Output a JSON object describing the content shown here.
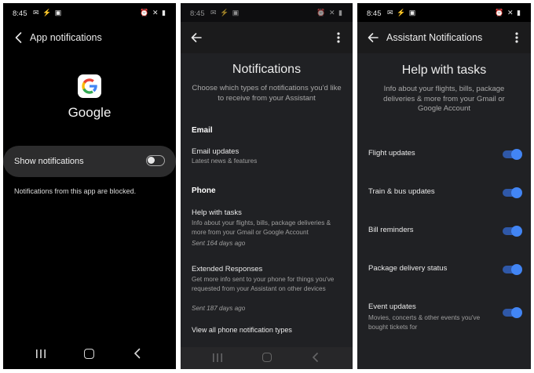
{
  "screen1": {
    "status_time": "8:45",
    "status_icons_left": "✉ ⚡ ▣",
    "status_icons_right": "⏰ ✕ ▮",
    "title": "App notifications",
    "app_name": "Google",
    "show_label": "Show notifications",
    "show_toggle_on": false,
    "blocked_text": "Notifications from this app are blocked."
  },
  "screen2": {
    "status_time": "8:45",
    "status_icons_left": "✉ ⚡ ▣",
    "status_icons_right": "⏰ ✕ ▮",
    "title": "Notifications",
    "subtitle": "Choose which types of notifications you'd like to receive from your Assistant",
    "email_section": "Email",
    "email_updates": {
      "title": "Email updates",
      "desc": "Latest news & features"
    },
    "phone_section": "Phone",
    "help_tasks": {
      "title": "Help with tasks",
      "desc": "Info about your flights, bills, package deliveries & more from your Gmail or Google Account",
      "meta": "Sent 164 days ago"
    },
    "extended": {
      "title": "Extended Responses",
      "desc": "Get more info sent to your phone for things you've requested from your Assistant on other devices",
      "meta": "Sent 187 days ago"
    },
    "view_all": "View all phone notification types"
  },
  "screen3": {
    "status_time": "8:45",
    "status_icons_left": "✉ ⚡ ▣",
    "status_icons_right": "⏰ ✕ ▮",
    "title": "Assistant Notifications",
    "heading": "Help with tasks",
    "subtitle": "Info about your flights, bills, package deliveries & more from your Gmail or Google Account",
    "toggles": [
      {
        "label": "Flight updates",
        "desc": "",
        "on": true
      },
      {
        "label": "Train & bus updates",
        "desc": "",
        "on": true
      },
      {
        "label": "Bill reminders",
        "desc": "",
        "on": true
      },
      {
        "label": "Package delivery status",
        "desc": "",
        "on": true
      },
      {
        "label": "Event updates",
        "desc": "Movies, concerts & other events you've bought tickets for",
        "on": true
      }
    ]
  },
  "colors": {
    "screen1_bg": "#000000",
    "assistant_bg": "#202124",
    "toggle_on": "#4285f4",
    "google_blue": "#4285F4",
    "google_red": "#EA4335",
    "google_yellow": "#FBBC05",
    "google_green": "#34A853"
  },
  "icons": [
    "back-arrow-icon",
    "more-vert-icon",
    "google-g-icon",
    "recents-icon",
    "home-icon",
    "nav-back-icon"
  ]
}
